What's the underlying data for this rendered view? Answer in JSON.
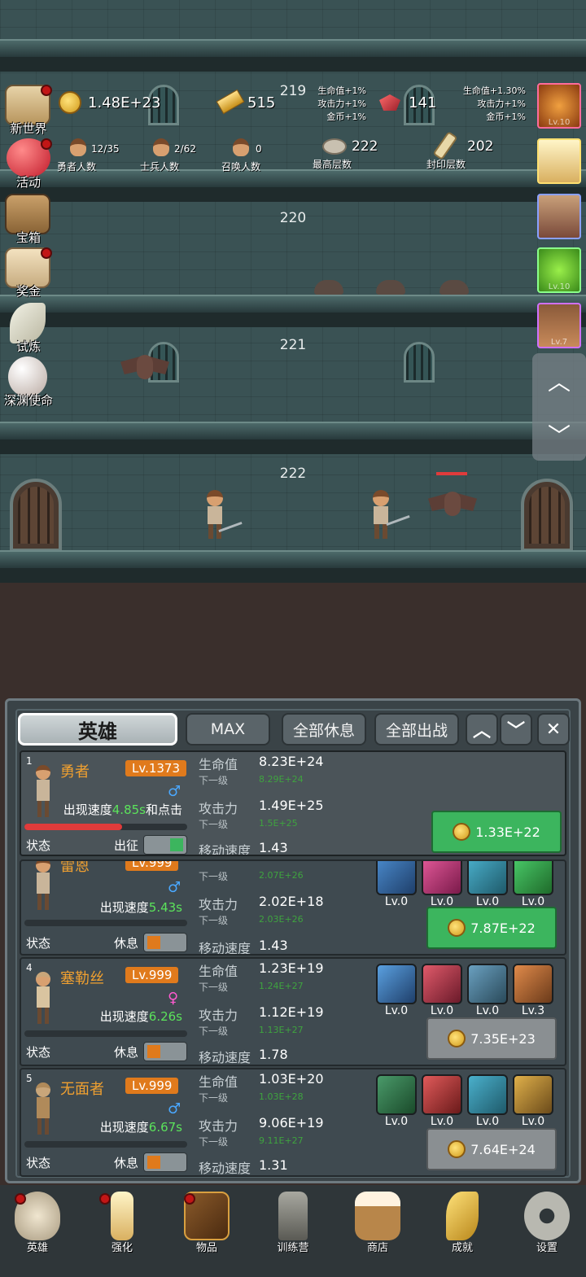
{
  "tower": {
    "floors": [
      {
        "number": "219"
      },
      {
        "number": "220"
      },
      {
        "number": "221"
      },
      {
        "number": "222"
      }
    ]
  },
  "hud": {
    "coins": "1.48E+23",
    "gold": "515",
    "gold_bonus": [
      "生命值+1%",
      "攻击力+1%",
      "金币+1%"
    ],
    "gems": "141",
    "gem_bonus": [
      "生命值+1.30%",
      "攻击力+1%",
      "金币+1%"
    ],
    "hero_count": "12/35",
    "hero_count_label": "勇者人数",
    "soldier_count": "2/62",
    "soldier_count_label": "士兵人数",
    "summon_count": "0",
    "summon_count_label": "召唤人数",
    "max_floor": "222",
    "max_floor_label": "最高层数",
    "sealed_floor": "202",
    "sealed_floor_label": "封印层数"
  },
  "left_menu": [
    {
      "label": "新世界",
      "badge": true
    },
    {
      "label": "活动",
      "badge": true
    },
    {
      "label": "宝箱",
      "badge": false
    },
    {
      "label": "奖金",
      "badge": true
    },
    {
      "label": "试炼",
      "badge": false
    },
    {
      "label": "深渊使命",
      "badge": false
    }
  ],
  "right_column": [
    {
      "name": "fruit-slot",
      "lv": "Lv.10"
    },
    {
      "name": "candle-slot",
      "lv": ""
    },
    {
      "name": "chest-slot",
      "lv": ""
    },
    {
      "name": "slime-slot",
      "lv": "Lv.10"
    },
    {
      "name": "hero-slot",
      "lv": "Lv.7"
    }
  ],
  "scroll": {
    "up": "︿",
    "down": "﹀"
  },
  "panel": {
    "tabs": {
      "heroes": "英雄",
      "max": "MAX",
      "rest_all": "全部休息",
      "deploy_all": "全部出战"
    },
    "icons": {
      "up": "︿",
      "down": "﹀",
      "close": "✕"
    }
  },
  "labels": {
    "hp": "生命值",
    "atk": "攻击力",
    "next": "下一级",
    "move_speed": "移动速度",
    "status": "状态",
    "appear_prefix": "出现速度"
  },
  "heroes": [
    {
      "index": "1",
      "name": "勇者",
      "level": "Lv.1373",
      "gender": "♂",
      "appear_speed": "4.85s",
      "appear_suffix": "和点击",
      "hp": "8.23E+24",
      "hp_next": "8.29E+24",
      "atk": "1.49E+25",
      "atk_next": "1.5E+25",
      "move_speed": "1.43",
      "state": "出征",
      "hp_fill": 0.6,
      "cost": "1.33E+22",
      "cost_enabled": true
    },
    {
      "index": "",
      "name": "雷恩",
      "level": "Lv.999",
      "gender": "♂",
      "appear_speed": "5.43s",
      "appear_suffix": "",
      "hp_next_top": "2.07E+26",
      "atk": "2.02E+18",
      "atk_next": "2.03E+26",
      "move_speed": "1.43",
      "state": "休息",
      "cost": "7.87E+22",
      "cost_enabled": true,
      "equip_levels": [
        "Lv.0",
        "Lv.0",
        "Lv.0",
        "Lv.0"
      ]
    },
    {
      "index": "4",
      "name": "塞勒丝",
      "level": "Lv.999",
      "gender": "♀",
      "appear_speed": "6.26s",
      "appear_suffix": "",
      "hp": "1.23E+19",
      "hp_next": "1.24E+27",
      "atk": "1.12E+19",
      "atk_next": "1.13E+27",
      "move_speed": "1.78",
      "state": "休息",
      "cost": "7.35E+23",
      "cost_enabled": false,
      "equip_levels": [
        "Lv.0",
        "Lv.0",
        "Lv.0",
        "Lv.3"
      ]
    },
    {
      "index": "5",
      "name": "无面者",
      "level": "Lv.999",
      "gender": "♂",
      "appear_speed": "6.67s",
      "appear_suffix": "",
      "hp": "1.03E+20",
      "hp_next": "1.03E+28",
      "atk": "9.06E+19",
      "atk_next": "9.11E+27",
      "move_speed": "1.31",
      "state": "休息",
      "cost": "7.64E+24",
      "cost_enabled": false,
      "equip_levels": [
        "Lv.0",
        "Lv.0",
        "Lv.0",
        "Lv.0"
      ]
    }
  ],
  "bottom_nav": [
    {
      "label": "英雄",
      "badge": true
    },
    {
      "label": "强化",
      "badge": true
    },
    {
      "label": "物品",
      "badge": true
    },
    {
      "label": "训练营",
      "badge": false
    },
    {
      "label": "商店",
      "badge": false
    },
    {
      "label": "成就",
      "badge": false
    },
    {
      "label": "设置",
      "badge": false
    }
  ],
  "colors": {
    "accent_orange": "#e07a1c",
    "green": "#3cb55e",
    "speed_green": "#5be35b",
    "badge_red": "#c21616"
  }
}
